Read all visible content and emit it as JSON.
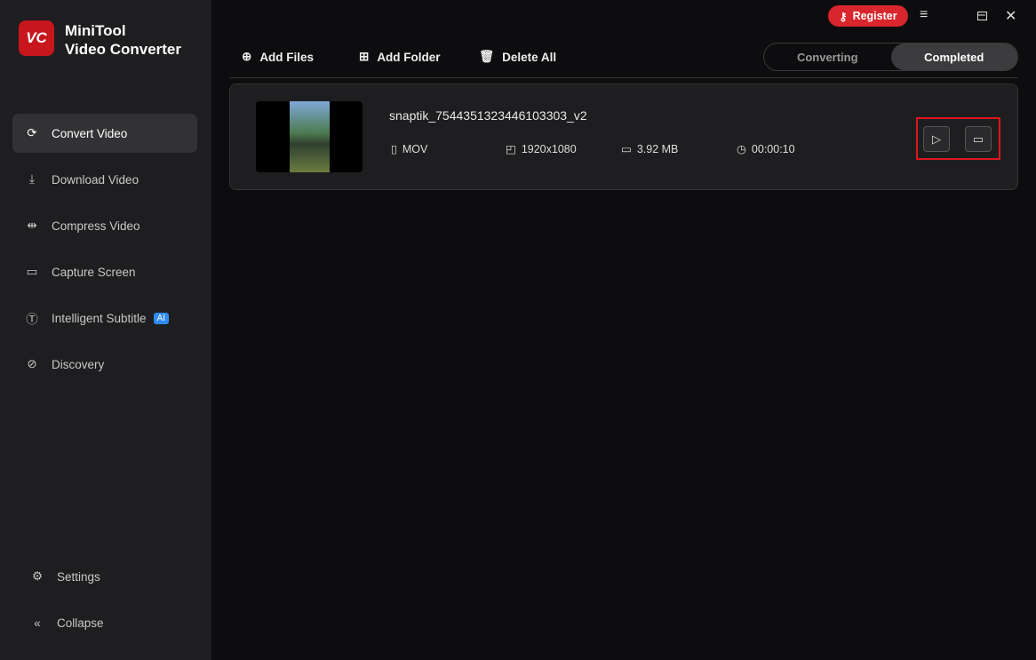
{
  "app": {
    "logo_text": "VC",
    "name_line1": "MiniTool",
    "name_line2": "Video Converter"
  },
  "sidebar": {
    "items": [
      {
        "label": "Convert Video"
      },
      {
        "label": "Download Video"
      },
      {
        "label": "Compress Video"
      },
      {
        "label": "Capture Screen"
      },
      {
        "label": "Intelligent Subtitle",
        "badge": "AI"
      },
      {
        "label": "Discovery"
      }
    ],
    "settings": "Settings",
    "collapse": "Collapse"
  },
  "header": {
    "register": "Register"
  },
  "toolbar": {
    "add_files": "Add Files",
    "add_folder": "Add Folder",
    "delete_all": "Delete All",
    "tabs": [
      "Converting",
      "Completed"
    ]
  },
  "file": {
    "name": "snaptik_7544351323446103303_v2",
    "format": "MOV",
    "resolution": "1920x1080",
    "size": "3.92 MB",
    "duration": "00:00:10"
  },
  "colors": {
    "accent": "#d8262c"
  }
}
